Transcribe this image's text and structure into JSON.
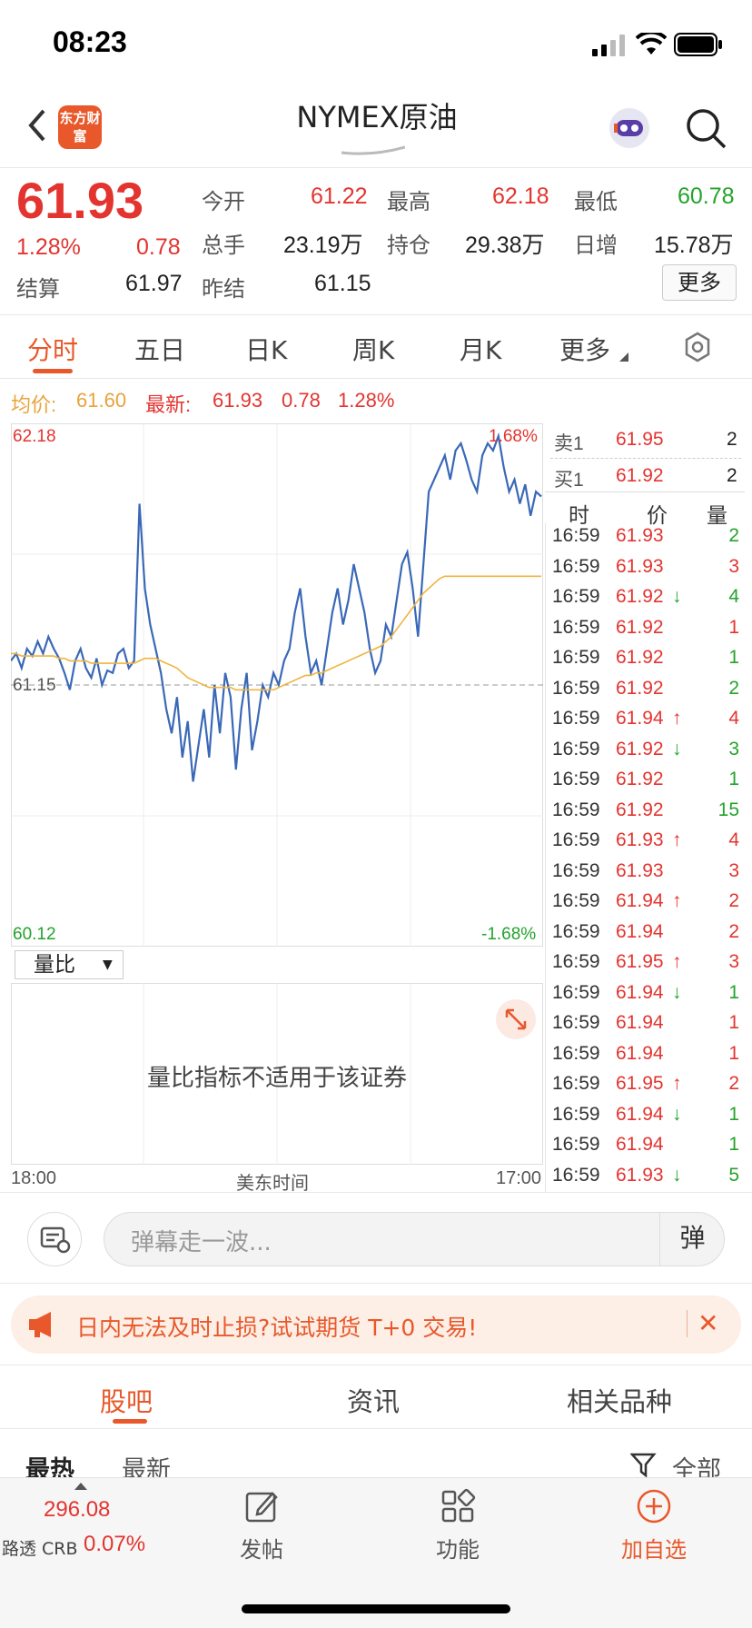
{
  "status_bar": {
    "time": "08:23"
  },
  "header": {
    "title": "NYMEX原油",
    "logo_text": "东方财富"
  },
  "quote": {
    "price": "61.93",
    "change_pct": "1.28%",
    "change": "0.78",
    "fields": {
      "open_label": "今开",
      "open": "61.22",
      "high_label": "最高",
      "high": "62.18",
      "low_label": "最低",
      "low": "60.78",
      "volume_label": "总手",
      "volume": "23.19万",
      "oi_label": "持仓",
      "oi": "29.38万",
      "day_inc_label": "日增",
      "day_inc": "15.78万",
      "settle_label": "结算",
      "settle": "61.97",
      "prev_settle_label": "昨结",
      "prev_settle": "61.15"
    },
    "more_button": "更多"
  },
  "tabs": [
    "分时",
    "五日",
    "日K",
    "周K",
    "月K",
    "更多"
  ],
  "info_line": {
    "avg_label": "均价:",
    "avg": "61.60",
    "latest_label": "最新:",
    "latest": "61.93",
    "change": "0.78",
    "change_pct": "1.28%"
  },
  "chart_data": {
    "type": "line",
    "title": "",
    "xlabel": "美东时间",
    "x_tick_labels": [
      "18:00",
      "17:00"
    ],
    "ylim": [
      60.12,
      62.18
    ],
    "y_top_label": "62.18",
    "y_bottom_label": "60.12",
    "pct_top_label": "1.68%",
    "pct_bottom_label": "-1.68%",
    "reference_line": {
      "value": 61.15,
      "label": "61.15"
    },
    "series": [
      {
        "color": "#3a68b8",
        "values": [
          61.25,
          61.28,
          61.22,
          61.3,
          61.27,
          61.33,
          61.28,
          61.35,
          61.3,
          61.26,
          61.2,
          61.13,
          61.25,
          61.3,
          61.22,
          61.18,
          61.26,
          61.15,
          61.21,
          61.2,
          61.28,
          61.3,
          61.22,
          61.25,
          61.9,
          61.55,
          61.4,
          61.3,
          61.2,
          61.05,
          60.95,
          61.1,
          60.85,
          61.0,
          60.75,
          60.9,
          61.05,
          60.85,
          61.15,
          60.95,
          61.2,
          61.1,
          60.8,
          61.05,
          61.2,
          60.88,
          61.0,
          61.15,
          61.1,
          61.2,
          61.15,
          61.25,
          61.3,
          61.45,
          61.55,
          61.35,
          61.2,
          61.25,
          61.15,
          61.3,
          61.45,
          61.55,
          61.4,
          61.5,
          61.65,
          61.55,
          61.45,
          61.3,
          61.2,
          61.25,
          61.4,
          61.35,
          61.5,
          61.65,
          61.7,
          61.55,
          61.35,
          61.65,
          61.95,
          62.0,
          62.05,
          62.1,
          62.0,
          62.12,
          62.15,
          62.08,
          62.0,
          61.95,
          62.1,
          62.15,
          62.12,
          62.18,
          62.05,
          61.95,
          62.0,
          61.9,
          61.98,
          61.85,
          61.95,
          61.93
        ]
      },
      {
        "color": "#f0b43c",
        "values": [
          61.28,
          61.28,
          61.27,
          61.27,
          61.27,
          61.27,
          61.27,
          61.27,
          61.27,
          61.26,
          61.26,
          61.25,
          61.25,
          61.25,
          61.25,
          61.24,
          61.24,
          61.24,
          61.24,
          61.24,
          61.24,
          61.24,
          61.24,
          61.24,
          61.25,
          61.26,
          61.26,
          61.26,
          61.25,
          61.24,
          61.23,
          61.22,
          61.2,
          61.18,
          61.17,
          61.16,
          61.15,
          61.14,
          61.14,
          61.14,
          61.14,
          61.14,
          61.13,
          61.13,
          61.13,
          61.13,
          61.13,
          61.13,
          61.13,
          61.13,
          61.14,
          61.15,
          61.16,
          61.17,
          61.18,
          61.19,
          61.19,
          61.2,
          61.2,
          61.21,
          61.22,
          61.23,
          61.24,
          61.25,
          61.26,
          61.27,
          61.28,
          61.29,
          61.3,
          61.31,
          61.33,
          61.35,
          61.38,
          61.41,
          61.44,
          61.47,
          61.5,
          61.53,
          61.55,
          61.57,
          61.59,
          61.6,
          61.6,
          61.6,
          61.6,
          61.6,
          61.6,
          61.6,
          61.6,
          61.6,
          61.6,
          61.6,
          61.6,
          61.6,
          61.6,
          61.6,
          61.6,
          61.6,
          61.6,
          61.6
        ]
      }
    ]
  },
  "sub_chart": {
    "indicator": "量比",
    "message": "量比指标不适用于该证券"
  },
  "order_book": {
    "ask_label": "卖1",
    "ask_price": "61.95",
    "ask_vol": "2",
    "bid_label": "买1",
    "bid_price": "61.92",
    "bid_vol": "2",
    "col_time": "时",
    "col_price": "价",
    "col_vol": "量"
  },
  "ticks": [
    {
      "time": "16:59",
      "price": "61.93",
      "arrow": "",
      "vol": "2",
      "vcolor": "green"
    },
    {
      "time": "16:59",
      "price": "61.93",
      "arrow": "",
      "vol": "3",
      "vcolor": "red"
    },
    {
      "time": "16:59",
      "price": "61.92",
      "arrow": "↓",
      "vol": "4",
      "vcolor": "green"
    },
    {
      "time": "16:59",
      "price": "61.92",
      "arrow": "",
      "vol": "1",
      "vcolor": "red"
    },
    {
      "time": "16:59",
      "price": "61.92",
      "arrow": "",
      "vol": "1",
      "vcolor": "green"
    },
    {
      "time": "16:59",
      "price": "61.92",
      "arrow": "",
      "vol": "2",
      "vcolor": "green"
    },
    {
      "time": "16:59",
      "price": "61.94",
      "arrow": "↑",
      "vol": "4",
      "vcolor": "red"
    },
    {
      "time": "16:59",
      "price": "61.92",
      "arrow": "↓",
      "vol": "3",
      "vcolor": "green"
    },
    {
      "time": "16:59",
      "price": "61.92",
      "arrow": "",
      "vol": "1",
      "vcolor": "green"
    },
    {
      "time": "16:59",
      "price": "61.92",
      "arrow": "",
      "vol": "15",
      "vcolor": "green"
    },
    {
      "time": "16:59",
      "price": "61.93",
      "arrow": "↑",
      "vol": "4",
      "vcolor": "red"
    },
    {
      "time": "16:59",
      "price": "61.93",
      "arrow": "",
      "vol": "3",
      "vcolor": "red"
    },
    {
      "time": "16:59",
      "price": "61.94",
      "arrow": "↑",
      "vol": "2",
      "vcolor": "red"
    },
    {
      "time": "16:59",
      "price": "61.94",
      "arrow": "",
      "vol": "2",
      "vcolor": "red"
    },
    {
      "time": "16:59",
      "price": "61.95",
      "arrow": "↑",
      "vol": "3",
      "vcolor": "red"
    },
    {
      "time": "16:59",
      "price": "61.94",
      "arrow": "↓",
      "vol": "1",
      "vcolor": "green"
    },
    {
      "time": "16:59",
      "price": "61.94",
      "arrow": "",
      "vol": "1",
      "vcolor": "red"
    },
    {
      "time": "16:59",
      "price": "61.94",
      "arrow": "",
      "vol": "1",
      "vcolor": "red"
    },
    {
      "time": "16:59",
      "price": "61.95",
      "arrow": "↑",
      "vol": "2",
      "vcolor": "red"
    },
    {
      "time": "16:59",
      "price": "61.94",
      "arrow": "↓",
      "vol": "1",
      "vcolor": "green"
    },
    {
      "time": "16:59",
      "price": "61.94",
      "arrow": "",
      "vol": "1",
      "vcolor": "green"
    },
    {
      "time": "16:59",
      "price": "61.93",
      "arrow": "↓",
      "vol": "5",
      "vcolor": "green"
    }
  ],
  "comment": {
    "placeholder": "弹幕走一波...",
    "button": "弹"
  },
  "banner": {
    "text": "日内无法及时止损?试试期货 T+0 交易!"
  },
  "bottom_tabs": [
    "股吧",
    "资讯",
    "相关品种"
  ],
  "sub_tabs": {
    "hot": "最热",
    "new": "最新",
    "filter": "全部"
  },
  "tabbar": {
    "index_value": "296.08",
    "index_name": "路透 CRB",
    "index_change": "0.07%",
    "post": "发帖",
    "func": "功能",
    "watch": "加自选"
  },
  "colors": {
    "up": "#e3342f",
    "down": "#23a32b",
    "accent": "#e8582a",
    "price_line": "#3a68b8",
    "avg_line": "#f0b43c"
  }
}
